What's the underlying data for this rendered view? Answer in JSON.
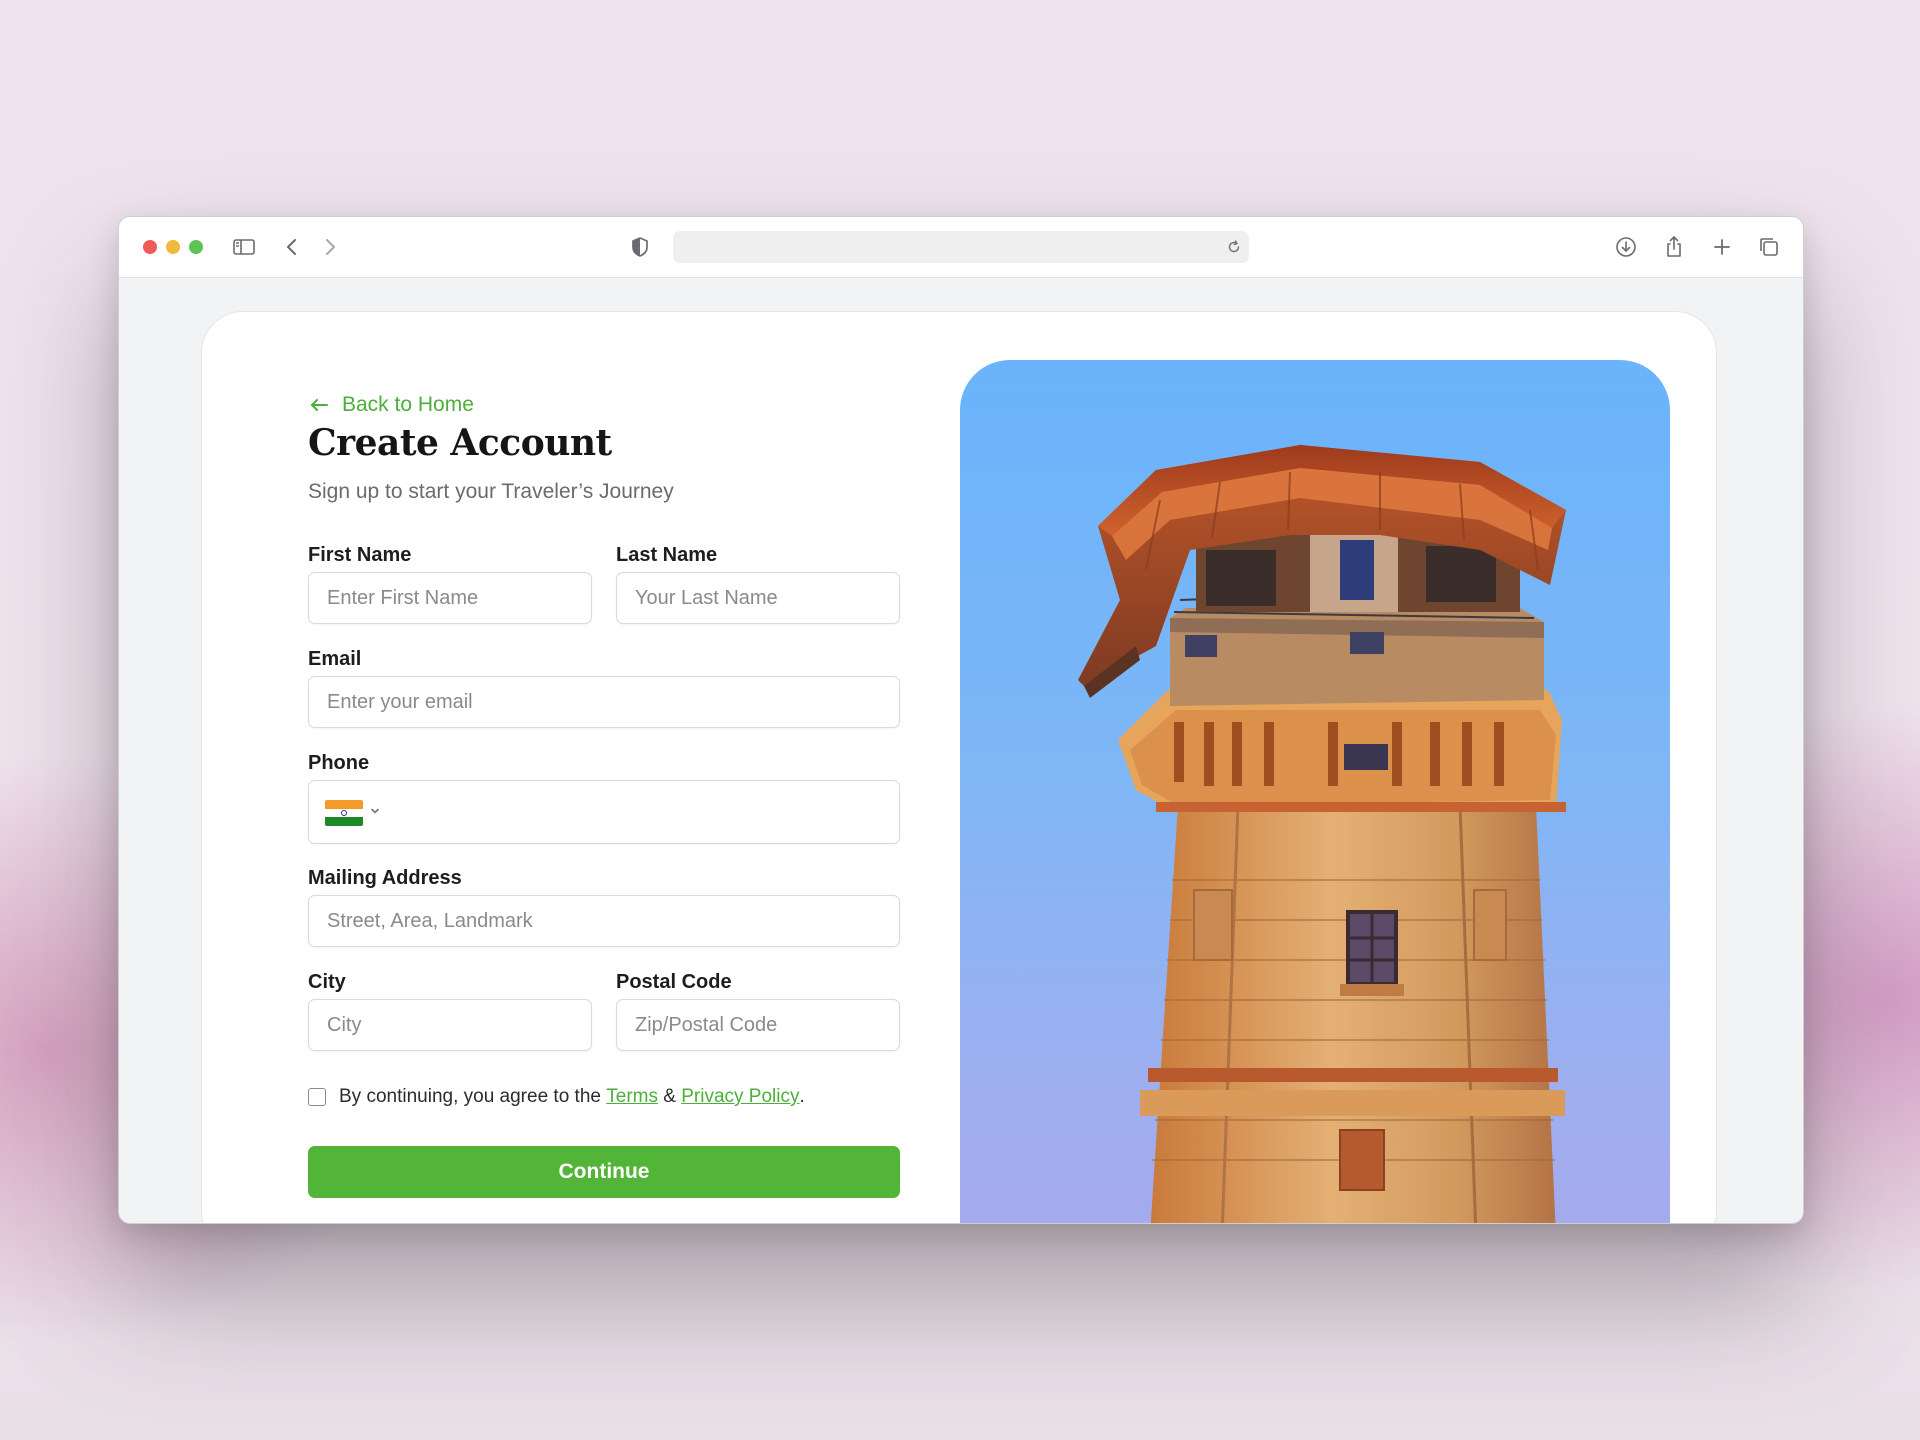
{
  "browser": {
    "url": "",
    "icons": [
      "sidebar-icon",
      "back-icon",
      "forward-icon",
      "shield-icon",
      "reload-icon",
      "download-icon",
      "share-icon",
      "new-tab-icon",
      "tabs-icon"
    ]
  },
  "form": {
    "back_link": "Back to Home",
    "title": "Create Account",
    "subtitle": "Sign up to start your Traveler’s Journey",
    "first_name": {
      "label": "First Name",
      "placeholder": "Enter First Name",
      "value": ""
    },
    "last_name": {
      "label": "Last Name",
      "placeholder": "Your Last Name",
      "value": ""
    },
    "email": {
      "label": "Email",
      "placeholder": "Enter your email",
      "value": ""
    },
    "phone": {
      "label": "Phone",
      "country_flag": "india-flag-icon",
      "value": ""
    },
    "address": {
      "label": "Mailing Address",
      "placeholder": "Street, Area, Landmark",
      "value": ""
    },
    "city": {
      "label": "City",
      "placeholder": "City",
      "value": ""
    },
    "postal": {
      "label": "Postal Code",
      "placeholder": "Zip/Postal Code",
      "value": ""
    },
    "terms": {
      "checked": false,
      "prefix": "By continuing, you agree to the",
      "terms_link": "Terms",
      "amp": "&",
      "privacy_link": "Privacy Policy",
      "suffix": "."
    },
    "submit_label": "Continue"
  },
  "colors": {
    "accent": "#53b538",
    "link": "#4caf3a",
    "sky": "#6ab4fb"
  }
}
